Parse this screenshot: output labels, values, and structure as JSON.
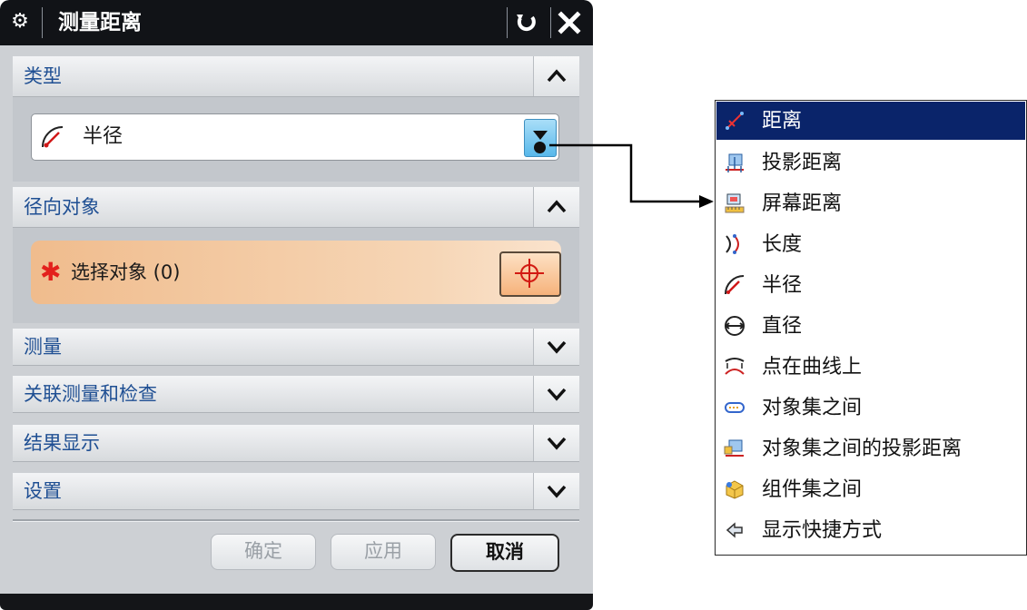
{
  "dialog": {
    "title": "测量距离",
    "title_icon": "gear-icon",
    "reset_icon": "undo-icon",
    "close_icon": "close-icon"
  },
  "sections": {
    "type": {
      "label": "类型",
      "state": "expanded",
      "dropdown_value": "半径",
      "dropdown_icon": "radius-icon"
    },
    "radial_object": {
      "label": "径向对象",
      "state": "expanded",
      "select_label": "选择对象 (0)",
      "select_count": 0
    },
    "measure": {
      "label": "测量",
      "state": "collapsed"
    },
    "associative": {
      "label": "关联测量和检查",
      "state": "collapsed"
    },
    "result_display": {
      "label": "结果显示",
      "state": "collapsed"
    },
    "settings": {
      "label": "设置",
      "state": "collapsed"
    }
  },
  "buttons": {
    "ok": "确定",
    "apply": "应用",
    "cancel": "取消"
  },
  "menu": {
    "items": [
      {
        "label": "距离",
        "icon": "distance-icon",
        "selected": true
      },
      {
        "label": "投影距离",
        "icon": "projected-distance-icon"
      },
      {
        "label": "屏幕距离",
        "icon": "screen-distance-icon"
      },
      {
        "label": "长度",
        "icon": "length-icon"
      },
      {
        "label": "半径",
        "icon": "radius-icon"
      },
      {
        "label": "直径",
        "icon": "diameter-icon"
      },
      {
        "label": "点在曲线上",
        "icon": "point-on-curve-icon"
      },
      {
        "label": "对象集之间",
        "icon": "between-sets-icon"
      },
      {
        "label": "对象集之间的投影距离",
        "icon": "projected-between-sets-icon"
      },
      {
        "label": "组件集之间",
        "icon": "between-components-icon"
      },
      {
        "label": "显示快捷方式",
        "icon": "show-shortcuts-icon"
      }
    ]
  },
  "colors": {
    "title_bar": "#111317",
    "section_label": "#1f4f93",
    "menu_selected": "#0a246a",
    "required_star": "#e3211c",
    "select_row": "#f0bc8d"
  }
}
